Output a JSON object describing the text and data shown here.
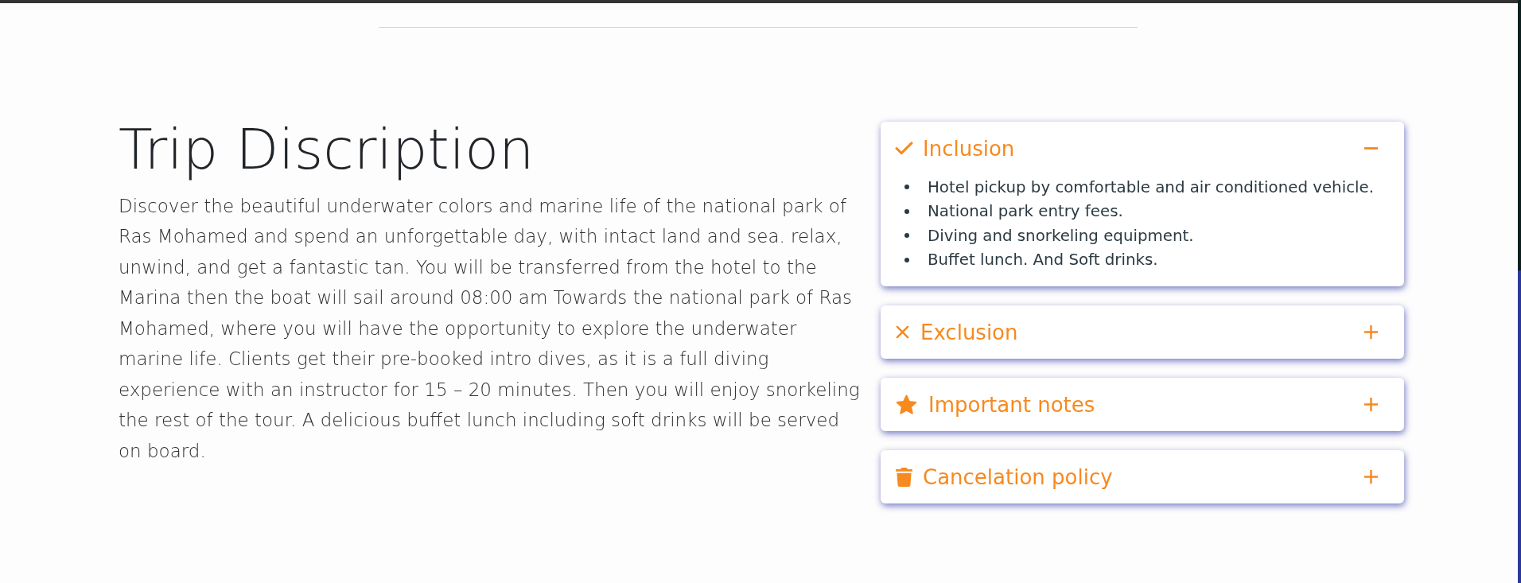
{
  "title": "Trip Discription",
  "description": "Discover the beautiful underwater colors and marine life of the national park of Ras Mohamed and spend an unforgettable day, with intact land and sea. relax, unwind, and get a fantastic tan. You will be transferred from the hotel to the Marina then the boat will sail around 08:00 am Towards the national park of Ras Mohamed, where you will have the opportunity to explore the underwater marine life. Clients get their pre-booked intro dives, as it is a full diving experience with an instructor for 15 – 20 minutes. Then you will enjoy snorkeling the rest of the tour. A delicious buffet lunch including soft drinks will be served on board.",
  "accordion": [
    {
      "title": "Inclusion",
      "expanded": true,
      "items": [
        "Hotel pickup by comfortable and air conditioned vehicle.",
        "National park entry fees.",
        "Diving and snorkeling equipment.",
        "Buffet lunch. And Soft drinks."
      ]
    },
    {
      "title": "Exclusion",
      "expanded": false
    },
    {
      "title": "Important notes",
      "expanded": false
    },
    {
      "title": "Cancelation policy",
      "expanded": false
    }
  ]
}
